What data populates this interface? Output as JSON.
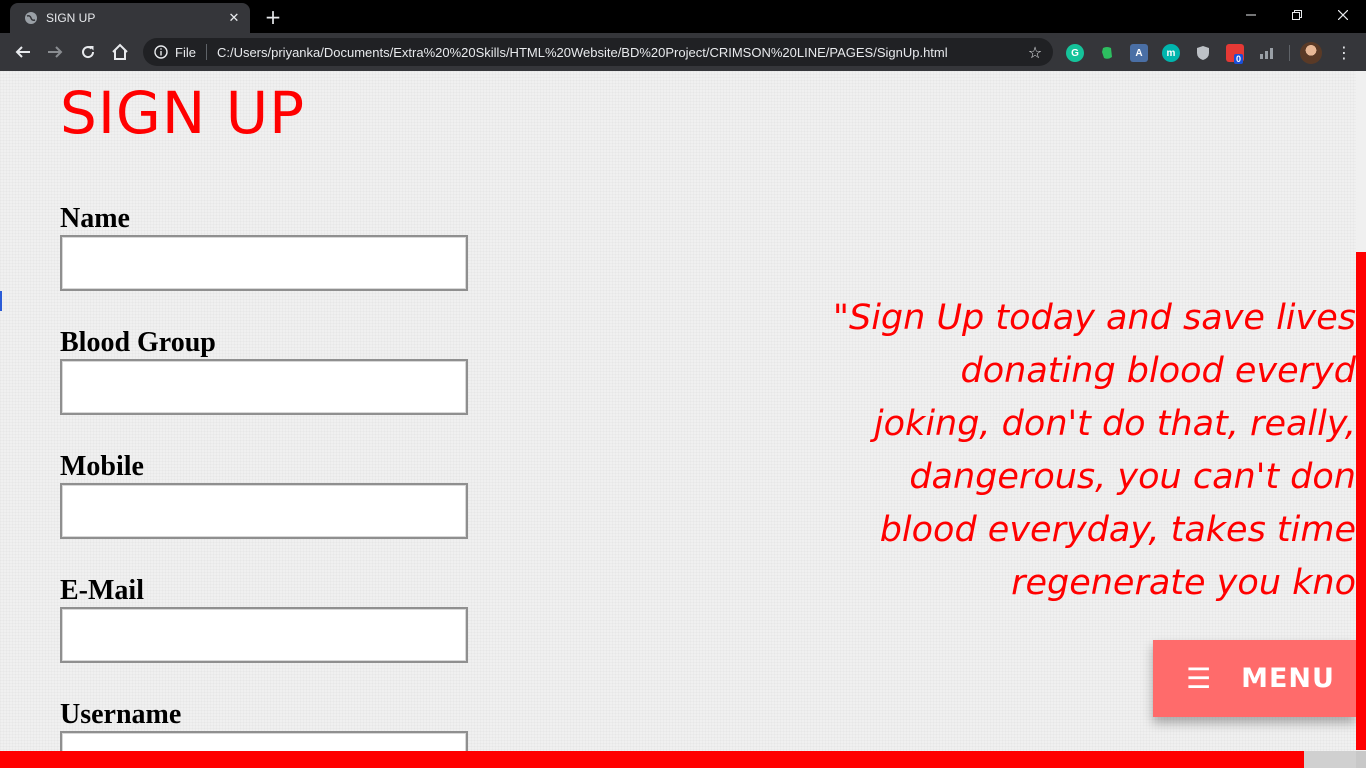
{
  "browser": {
    "tab": {
      "title": "SIGN UP",
      "favicon": "globe-icon",
      "close": "close-icon"
    },
    "new_tab": "new-tab-icon",
    "window": {
      "minimize": "minimize-icon",
      "maximize": "restore-icon",
      "close": "close-icon"
    },
    "nav": {
      "back": "back-arrow-icon",
      "forward": "forward-arrow-icon",
      "reload": "reload-icon",
      "home": "home-icon"
    },
    "address": {
      "scheme": "File",
      "url": "C:/Users/priyanka/Documents/Extra%20%20Skills/HTML%20Website/BD%20Project/CRIMSON%20LINE/PAGES/SignUp.html",
      "bookmark": "star-icon"
    },
    "extensions": [
      {
        "name": "grammarly-icon",
        "color": "#15c39a",
        "glyph": "G"
      },
      {
        "name": "evernote-icon",
        "color": "#2dbe60",
        "glyph": ""
      },
      {
        "name": "translate-icon",
        "color": "#4a90d9",
        "glyph": "A"
      },
      {
        "name": "mercury-icon",
        "color": "#00b5ad",
        "glyph": "m"
      },
      {
        "name": "shield-icon",
        "color": "#9aa0a6",
        "glyph": ""
      },
      {
        "name": "extension-badge-icon",
        "color": "#e53935",
        "glyph": "0"
      },
      {
        "name": "chart-icon",
        "color": "#9aa0a6",
        "glyph": ""
      }
    ]
  },
  "page": {
    "title": "SIGN UP",
    "fields": [
      {
        "label": "Name",
        "value": "",
        "placeholder": ""
      },
      {
        "label": "Blood Group",
        "value": "",
        "placeholder": ""
      },
      {
        "label": "Mobile",
        "value": "",
        "placeholder": ""
      },
      {
        "label": "E-Mail",
        "value": "",
        "placeholder": ""
      },
      {
        "label": "Username",
        "value": "",
        "placeholder": ""
      }
    ],
    "quote_lines": [
      "\"Sign Up today and save lives",
      "donating blood everyd",
      "joking, don't do that, really,",
      "dangerous, you can't don",
      "blood everyday, takes time",
      "regenerate you kno"
    ],
    "menu": {
      "icon": "☰",
      "label": "MENU"
    },
    "colors": {
      "accent": "#ff0000",
      "menu_bg": "#ff6b6b",
      "background": "#f0f0f0"
    }
  }
}
